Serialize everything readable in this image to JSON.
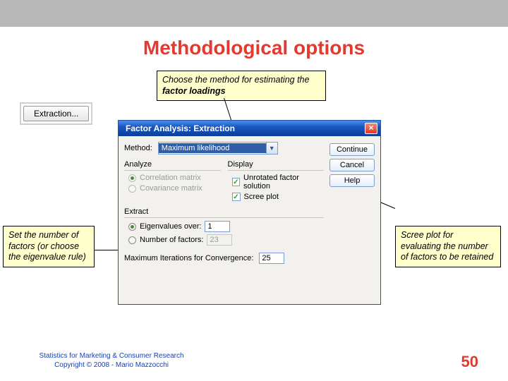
{
  "slide": {
    "title": "Methodological options",
    "page_number": "50",
    "citation_line1": "Statistics for Marketing & Consumer Research",
    "citation_line2": "Copyright © 2008 - Mario Mazzocchi"
  },
  "callouts": {
    "top_prefix": "Choose the method for estimating the ",
    "top_bold": "factor loadings",
    "left": "Set the number of factors (or choose the eigenvalue rule)",
    "right": "Scree plot for evaluating the number of factors to be retained"
  },
  "extraction_button": {
    "label": "Extraction..."
  },
  "dialog": {
    "title": "Factor Analysis: Extraction",
    "method_label": "Method:",
    "method_value": "Maximum likelihood",
    "analyze": {
      "title": "Analyze",
      "opt_corr": "Correlation matrix",
      "opt_cov": "Covariance matrix"
    },
    "display": {
      "title": "Display",
      "unrotated": "Unrotated factor solution",
      "scree": "Scree plot"
    },
    "extract": {
      "title": "Extract",
      "eigen_label": "Eigenvalues over:",
      "eigen_value": "1",
      "nfact_label": "Number of factors:",
      "nfact_value": "23"
    },
    "maxiter_label": "Maximum Iterations for Convergence:",
    "maxiter_value": "25",
    "buttons": {
      "continue": "Continue",
      "cancel": "Cancel",
      "help": "Help"
    }
  }
}
